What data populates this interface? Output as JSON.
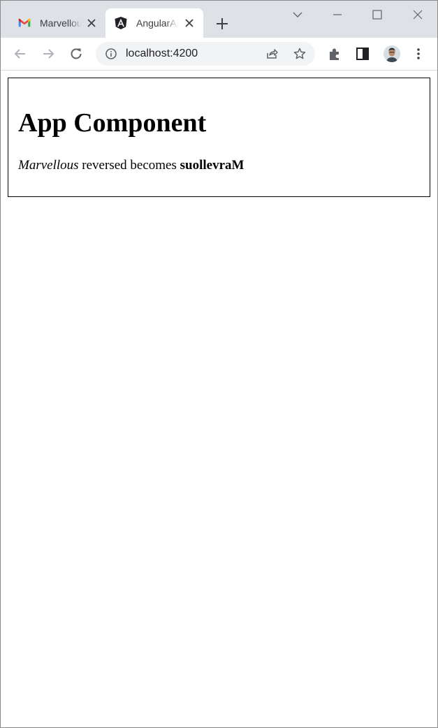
{
  "browser": {
    "tabs": [
      {
        "title": "Marvellous",
        "icon": "gmail-icon",
        "active": false
      },
      {
        "title": "AngularApp",
        "icon": "angular-icon",
        "active": true
      }
    ],
    "address_bar": {
      "url": "localhost:4200"
    }
  },
  "page": {
    "heading": "App Component",
    "sentence": {
      "input": "Marvellous",
      "middle": " reversed becomes ",
      "output": "suollevraM"
    }
  },
  "colors": {
    "tab_strip": "#dee1e6",
    "active_tab": "#ffffff",
    "omnibox": "#f1f3f4",
    "icon": "#5f6368",
    "angular_red": "#dd0031"
  }
}
